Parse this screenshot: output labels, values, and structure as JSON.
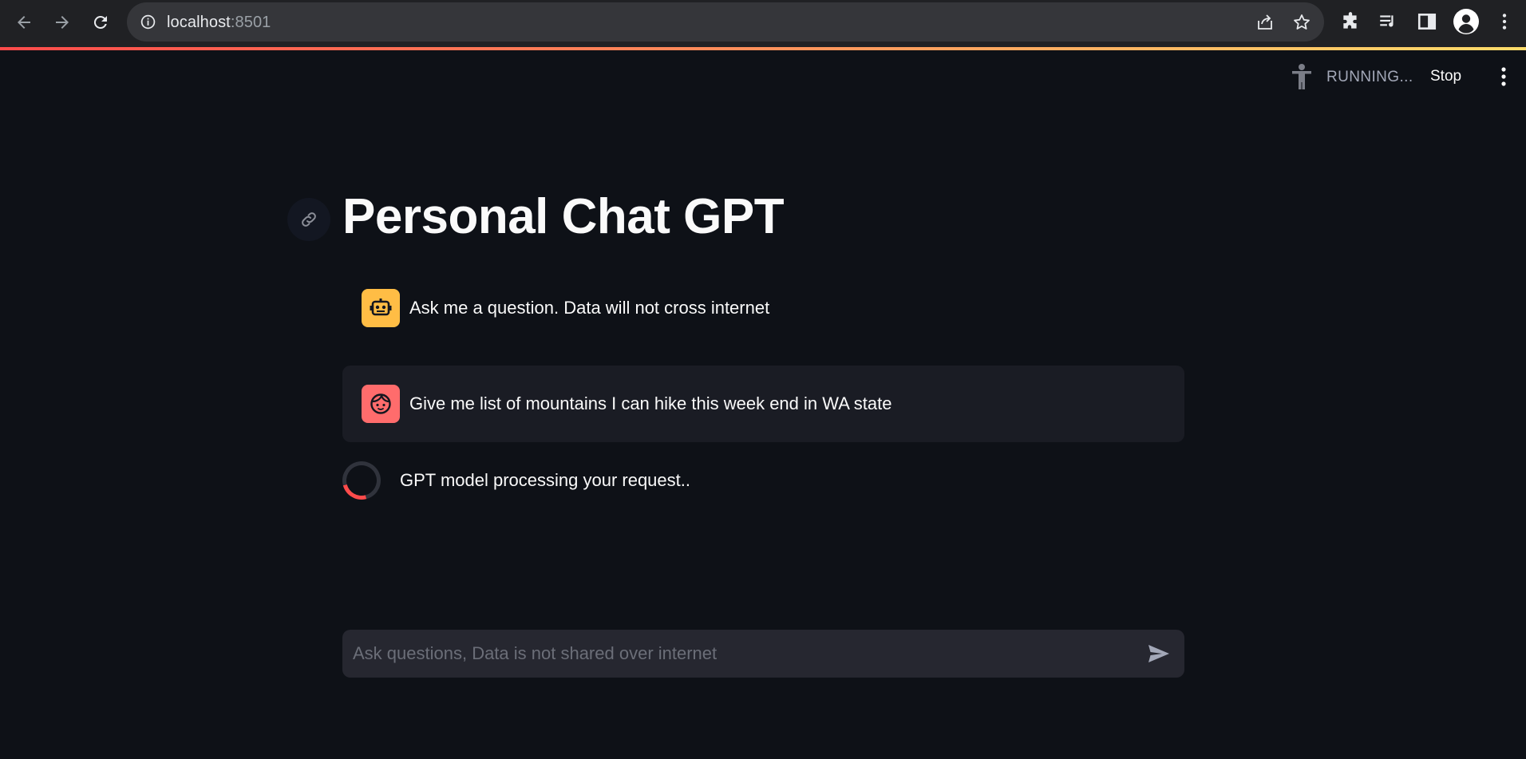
{
  "browser": {
    "url_host": "localhost",
    "url_port": ":8501"
  },
  "header": {
    "status_text": "RUNNING...",
    "stop_label": "Stop"
  },
  "main": {
    "title": "Personal Chat GPT",
    "messages": [
      {
        "role": "assistant",
        "avatar_icon": "robot-icon",
        "text": "Ask me a question. Data will not cross internet"
      },
      {
        "role": "user",
        "avatar_icon": "face-icon",
        "text": "Give me list of mountains I can hike this week end in WA state"
      }
    ],
    "spinner_text": "GPT model processing your request..",
    "chat_input": {
      "placeholder": "Ask questions, Data is not shared over internet",
      "value": ""
    }
  },
  "colors": {
    "background": "#0e1117",
    "accent": "#ff4b4b",
    "assistant_avatar": "#ffbd45",
    "user_avatar": "#ff6c6c",
    "user_message_bg": "#1a1c24",
    "input_bg": "#262730"
  }
}
